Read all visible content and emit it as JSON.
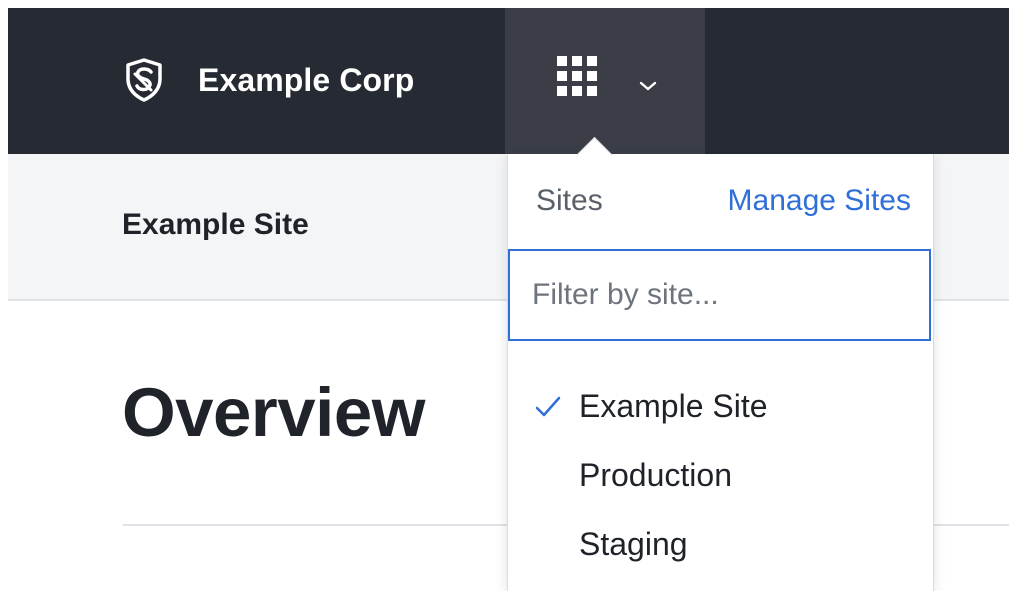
{
  "topbar": {
    "brand_name": "Example Corp",
    "logo_icon": "shield-logo-icon",
    "apps_icon": "apps-grid-icon",
    "menu_icon": "chevron-down-icon",
    "background_color": "#262a33",
    "active_tab_color": "#3b3e46"
  },
  "site_header": {
    "site_name": "Example Site"
  },
  "page": {
    "heading": "Overview"
  },
  "site_switcher": {
    "section_label": "Sites",
    "manage_link": "Manage Sites",
    "filter_placeholder": "Filter by site...",
    "filter_value": "",
    "accent_color": "#2f6fd8",
    "items": [
      {
        "label": "Example Site",
        "selected": true,
        "icon": "checkmark-icon"
      },
      {
        "label": "Production",
        "selected": false
      },
      {
        "label": "Staging",
        "selected": false
      }
    ]
  }
}
